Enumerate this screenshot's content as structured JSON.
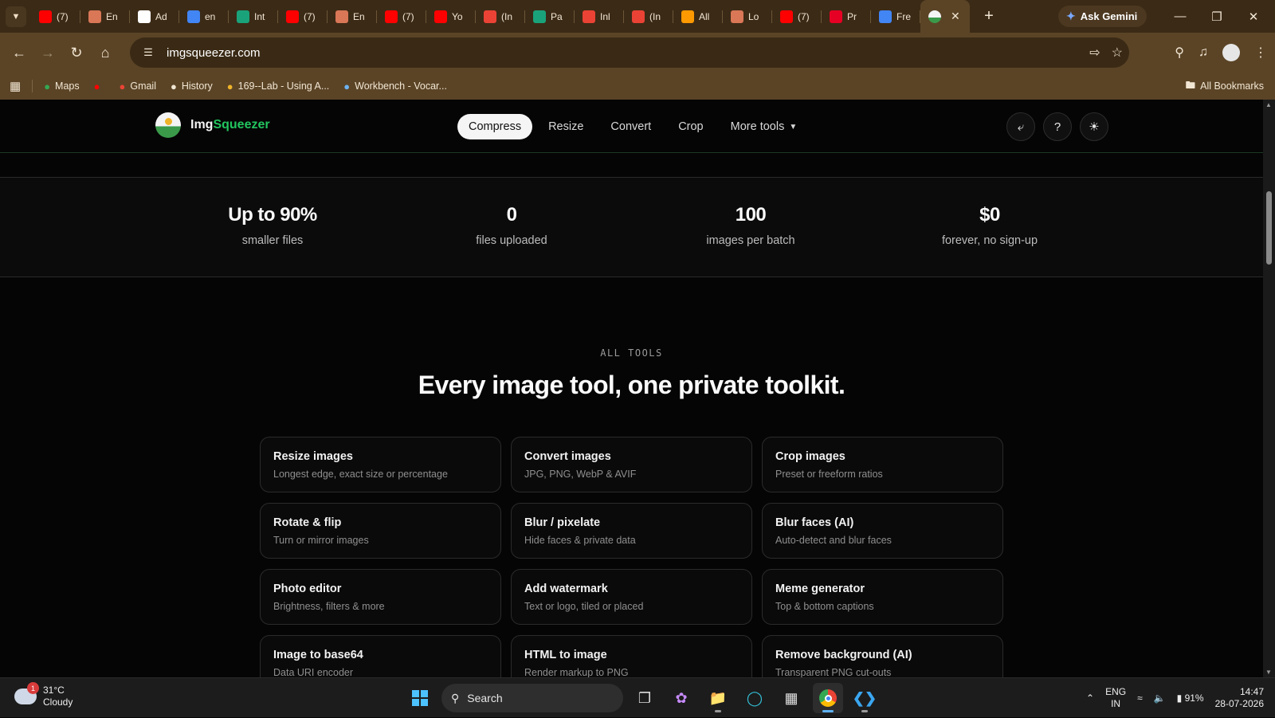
{
  "browser": {
    "tabs": [
      {
        "label": "(7)",
        "icon": "youtube-icon",
        "color": "#ff0000"
      },
      {
        "label": "En",
        "icon": "claude-icon",
        "color": "#d97757"
      },
      {
        "label": "Ad",
        "icon": "notion-icon",
        "color": "#ffffff"
      },
      {
        "label": "en",
        "icon": "google-icon",
        "color": "#4285f4"
      },
      {
        "label": "Int",
        "icon": "shield-icon",
        "color": "#1aa37a"
      },
      {
        "label": "(7)",
        "icon": "youtube-icon",
        "color": "#ff0000"
      },
      {
        "label": "En",
        "icon": "claude-icon",
        "color": "#d97757"
      },
      {
        "label": "(7)",
        "icon": "youtube-icon",
        "color": "#ff0000"
      },
      {
        "label": "Yo",
        "icon": "youtube-icon",
        "color": "#ff0000"
      },
      {
        "label": "(In",
        "icon": "gmail-icon",
        "color": "#ea4335"
      },
      {
        "label": "Pa",
        "icon": "shield-icon",
        "color": "#1aa37a"
      },
      {
        "label": "Inl",
        "icon": "gmail-icon",
        "color": "#ea4335"
      },
      {
        "label": "(In",
        "icon": "gmail-icon",
        "color": "#ea4335"
      },
      {
        "label": "All",
        "icon": "amazon-icon",
        "color": "#ff9900"
      },
      {
        "label": "Lo",
        "icon": "claude-icon",
        "color": "#d97757"
      },
      {
        "label": "(7)",
        "icon": "youtube-icon",
        "color": "#ff0000"
      },
      {
        "label": "Pr",
        "icon": "pinterest-icon",
        "color": "#e60023"
      },
      {
        "label": "Fre",
        "icon": "google-icon",
        "color": "#4285f4"
      }
    ],
    "gemini_label": "Ask Gemini",
    "url": "imgsqueezer.com",
    "bookmarks": [
      {
        "label": "Maps",
        "icon": "maps-icon",
        "color": "#34a853"
      },
      {
        "label": "",
        "icon": "youtube-icon",
        "color": "#ff0000"
      },
      {
        "label": "Gmail",
        "icon": "gmail-icon",
        "color": "#ea4335"
      },
      {
        "label": "History",
        "icon": "history-icon",
        "color": "#f1e6d4"
      },
      {
        "label": "169--Lab - Using A...",
        "icon": "lab-icon",
        "color": "#f0b429"
      },
      {
        "label": "Workbench - Vocar...",
        "icon": "vocareum-icon",
        "color": "#6db3f2"
      }
    ],
    "all_bookmarks": "All Bookmarks"
  },
  "site": {
    "logo_prefix": "Img",
    "logo_suffix": "Squeezer",
    "nav": [
      "Compress",
      "Resize",
      "Convert",
      "Crop",
      "More tools"
    ],
    "active_nav": "Compress",
    "stats": [
      {
        "value": "Up to 90%",
        "label": "smaller files"
      },
      {
        "value": "0",
        "label": "files uploaded"
      },
      {
        "value": "100",
        "label": "images per batch"
      },
      {
        "value": "$0",
        "label": "forever, no sign-up"
      }
    ],
    "eyebrow": "ALL TOOLS",
    "headline": "Every image tool, one private toolkit.",
    "tools": [
      {
        "title": "Resize images",
        "desc": "Longest edge, exact size or percentage"
      },
      {
        "title": "Convert images",
        "desc": "JPG, PNG, WebP & AVIF"
      },
      {
        "title": "Crop images",
        "desc": "Preset or freeform ratios"
      },
      {
        "title": "Rotate & flip",
        "desc": "Turn or mirror images"
      },
      {
        "title": "Blur / pixelate",
        "desc": "Hide faces & private data"
      },
      {
        "title": "Blur faces (AI)",
        "desc": "Auto-detect and blur faces"
      },
      {
        "title": "Photo editor",
        "desc": "Brightness, filters & more"
      },
      {
        "title": "Add watermark",
        "desc": "Text or logo, tiled or placed"
      },
      {
        "title": "Meme generator",
        "desc": "Top & bottom captions"
      },
      {
        "title": "Image to base64",
        "desc": "Data URI encoder"
      },
      {
        "title": "HTML to image",
        "desc": "Render markup to PNG"
      },
      {
        "title": "Remove background (AI)",
        "desc": "Transparent PNG cut-outs"
      }
    ]
  },
  "taskbar": {
    "weather_temp": "31°C",
    "weather_cond": "Cloudy",
    "weather_badge": "1",
    "search_label": "Search",
    "lang_line1": "ENG",
    "lang_line2": "IN",
    "battery": "91%",
    "time": "14:47",
    "date": "28-07-2026"
  }
}
